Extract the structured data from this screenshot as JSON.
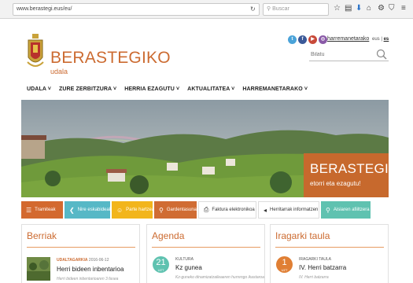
{
  "browser": {
    "url": "www.berastegi.eus/eu/",
    "search_placeholder": "Buscar"
  },
  "header": {
    "site_name": "BERASTEGIKO",
    "site_sub": "udala",
    "contact_link": "harremanetarako",
    "lang_eu": "eus",
    "lang_es": "es",
    "search_placeholder": "Bilatu"
  },
  "nav": [
    {
      "label": "UDALA ˅"
    },
    {
      "label": "ZURE ZERBITZURA ˅"
    },
    {
      "label": "HERRIA EZAGUTU ˅"
    },
    {
      "label": "AKTUALITATEA ˅"
    },
    {
      "label": "HARREMANETARAKO ˅"
    }
  ],
  "hero": {
    "title": "BERASTEGI",
    "subtitle": "etorri eta ezagutu!"
  },
  "quick_links": [
    {
      "label": "Tramiteak",
      "icon": "list-icon",
      "color": "#d3692f",
      "text_color": "#ffffff"
    },
    {
      "label": "Nire eskabideak",
      "icon": "chevron-left-icon",
      "color": "#57b8c6",
      "text_color": "#ffffff"
    },
    {
      "label": "Parte hartzea",
      "icon": "chat-icon",
      "color": "#f2b51c",
      "text_color": "#ffffff"
    },
    {
      "label": "Gardentasuna",
      "icon": "search-icon",
      "color": "#d06c33",
      "text_color": "#ffffff"
    },
    {
      "label": "Faktura elektronikoa",
      "icon": "printer-icon",
      "color": "#ffffff",
      "text_color": "#333333"
    },
    {
      "label": "Herritarrak informatzen",
      "icon": "megaphone-icon",
      "color": "#ffffff",
      "text_color": "#333333"
    },
    {
      "label": "Aisiaren afiiltzera",
      "icon": "pin-icon",
      "color": "#5fc2b0",
      "text_color": "#ffffff"
    }
  ],
  "news": {
    "heading": "Berriak",
    "category": "UDALTAGARKIA",
    "date": "2016-06-12",
    "title": "Herri bideen inbentarioa",
    "snippet": "Herri bideen inbentarioaren 3 fasea"
  },
  "agenda": {
    "heading": "Agenda",
    "day": "21",
    "month": "UZT",
    "category": "KULTURA",
    "title": "Kz gunea",
    "snippet": "Kz-guneko dinamizatzaileaeren hurrengo ikastaroa"
  },
  "notices": {
    "heading": "Iragarki taula",
    "day": "1",
    "month": "UZT",
    "category": "IRAGARKI TAULA",
    "title": "IV. Herri batzarra",
    "snippet": "IV. Herri batzarra"
  },
  "colors": {
    "brand": "#cc6b31",
    "agenda_circle": "#5fc2b0",
    "notice_circle": "#e07f34"
  }
}
